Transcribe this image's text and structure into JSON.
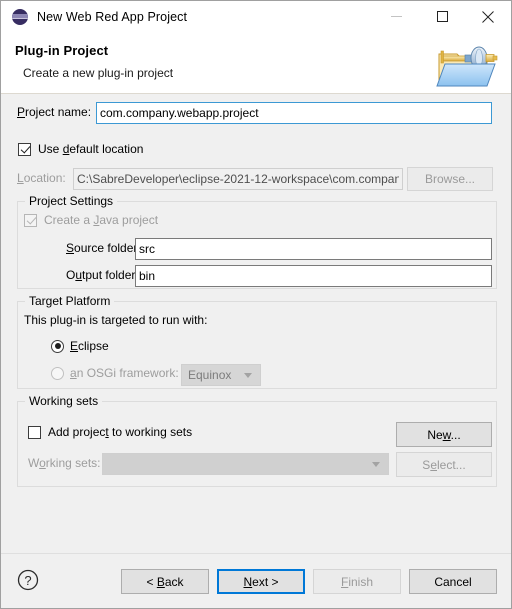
{
  "window": {
    "title": "New Web Red App Project",
    "icon": "eclipse-icon",
    "minimize_label": "Minimize",
    "maximize_label": "Maximize",
    "close_label": "Close"
  },
  "header": {
    "title": "Plug-in Project",
    "subtitle": "Create a new plug-in project",
    "icon": "plugin-project-banner-icon"
  },
  "project": {
    "name_label": "Project name:",
    "name_value": "com.company.webapp.project",
    "use_default_location_label": "Use default location",
    "use_default_location_checked": true,
    "location_label": "Location:",
    "location_value": "C:\\SabreDeveloper\\eclipse-2021-12-workspace\\com.compan",
    "browse_label": "Browse...",
    "browse_enabled": false
  },
  "project_settings": {
    "group_title": "Project Settings",
    "create_java_label": "Create a Java project",
    "create_java_checked": true,
    "create_java_enabled": false,
    "source_folder_label": "Source folder:",
    "source_folder_value": "src",
    "output_folder_label": "Output folder:",
    "output_folder_value": "bin"
  },
  "target_platform": {
    "group_title": "Target Platform",
    "description": "This plug-in is targeted to run with:",
    "eclipse_label": "Eclipse",
    "eclipse_selected": true,
    "osgi_label": "an OSGi framework:",
    "osgi_selected": false,
    "osgi_enabled": false,
    "osgi_framework_value": "Equinox"
  },
  "working_sets": {
    "group_title": "Working sets",
    "add_project_label": "Add project to working sets",
    "add_project_checked": false,
    "new_label": "New...",
    "new_enabled": true,
    "working_sets_label": "Working sets:",
    "working_sets_value": "",
    "select_label": "Select...",
    "select_enabled": false
  },
  "footer": {
    "help_icon": "help-icon",
    "back_label": "< Back",
    "next_label": "Next >",
    "finish_label": "Finish",
    "cancel_label": "Cancel",
    "finish_enabled": false,
    "default_button": "next"
  },
  "colors": {
    "accent": "#0078d7",
    "focus_border": "#3c99d4",
    "dialog_bg": "#f0f0f0",
    "titlebar_bg": "#ffffff",
    "disabled_text": "#9a9a9a"
  }
}
